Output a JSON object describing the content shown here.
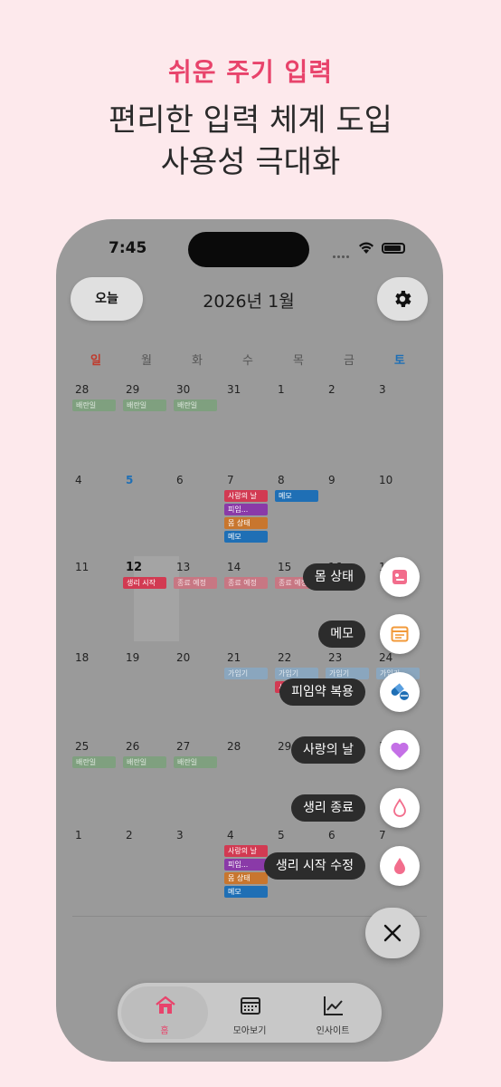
{
  "promo": {
    "tag": "쉬운 주기 입력",
    "line1": "편리한 입력 체계 도입",
    "line2": "사용성 극대화"
  },
  "status_bar": {
    "time": "7:45"
  },
  "header": {
    "today_label": "오늘",
    "month_title": "2026년 1월",
    "settings_icon": "gear-icon"
  },
  "weekdays": [
    "일",
    "월",
    "화",
    "수",
    "목",
    "금",
    "토"
  ],
  "weeks": [
    {
      "days": [
        "28",
        "29",
        "30",
        "31",
        "1",
        "2",
        "3"
      ],
      "events": [
        {
          "col": 0,
          "row": 0,
          "label": "배란일",
          "color": "#7fa07f",
          "text": "#dfe8df"
        },
        {
          "col": 1,
          "row": 0,
          "label": "배란일",
          "color": "#7fa07f",
          "text": "#dfe8df"
        },
        {
          "col": 2,
          "row": 0,
          "label": "배란일",
          "color": "#7fa07f",
          "text": "#dfe8df"
        }
      ]
    },
    {
      "days": [
        "4",
        "5",
        "6",
        "7",
        "8",
        "9",
        "10"
      ],
      "events": [
        {
          "col": 3,
          "row": 0,
          "label": "사랑의 날",
          "color": "#d23a52",
          "text": "#ffffff"
        },
        {
          "col": 3,
          "row": 1,
          "label": "피임...",
          "color": "#8a3aa8",
          "text": "#ffffff"
        },
        {
          "col": 3,
          "row": 2,
          "label": "몸 상태",
          "color": "#c8762e",
          "text": "#ffffff"
        },
        {
          "col": 3,
          "row": 3,
          "label": "메모",
          "color": "#1f6fb5",
          "text": "#ffffff"
        },
        {
          "col": 4,
          "row": 0,
          "label": "메모",
          "color": "#1f6fb5",
          "text": "#ffffff"
        }
      ]
    },
    {
      "days": [
        "11",
        "12",
        "13",
        "14",
        "15",
        "16",
        "17"
      ],
      "events": [
        {
          "col": 1,
          "row": 0,
          "label": "생리 시작",
          "color": "#d23a52",
          "text": "#ffffff"
        },
        {
          "col": 2,
          "row": 0,
          "label": "종료 예정",
          "color": "#c77783",
          "text": "#f3dde1"
        },
        {
          "col": 3,
          "row": 0,
          "label": "종료 예정",
          "color": "#c77783",
          "text": "#f3dde1"
        },
        {
          "col": 4,
          "row": 0,
          "label": "종료 예정",
          "color": "#c77783",
          "text": "#f3dde1"
        }
      ]
    },
    {
      "days": [
        "18",
        "19",
        "20",
        "21",
        "22",
        "23",
        "24"
      ],
      "events": [
        {
          "col": 3,
          "row": 0,
          "label": "가임기",
          "color": "#8aa6be",
          "text": "#dfe8f0"
        },
        {
          "col": 4,
          "row": 0,
          "label": "가임기",
          "color": "#8aa6be",
          "text": "#dfe8f0"
        },
        {
          "col": 4,
          "row": 1,
          "label": "사랑의 날",
          "color": "#d23a52",
          "text": "#ffffff"
        },
        {
          "col": 5,
          "row": 0,
          "label": "가임기",
          "color": "#8aa6be",
          "text": "#dfe8f0"
        },
        {
          "col": 6,
          "row": 0,
          "label": "가임기",
          "color": "#8aa6be",
          "text": "#dfe8f0"
        }
      ]
    },
    {
      "days": [
        "25",
        "26",
        "27",
        "28",
        "29",
        "30",
        "31"
      ],
      "events": [
        {
          "col": 0,
          "row": 0,
          "label": "배란일",
          "color": "#7fa07f",
          "text": "#dfe8df"
        },
        {
          "col": 1,
          "row": 0,
          "label": "배란일",
          "color": "#7fa07f",
          "text": "#dfe8df"
        },
        {
          "col": 2,
          "row": 0,
          "label": "배란일",
          "color": "#7fa07f",
          "text": "#dfe8df"
        }
      ]
    },
    {
      "days": [
        "1",
        "2",
        "3",
        "4",
        "5",
        "6",
        "7"
      ],
      "events": [
        {
          "col": 3,
          "row": 0,
          "label": "사랑의 날",
          "color": "#d23a52",
          "text": "#ffffff"
        },
        {
          "col": 3,
          "row": 1,
          "label": "피임...",
          "color": "#8a3aa8",
          "text": "#ffffff"
        },
        {
          "col": 3,
          "row": 2,
          "label": "몸 상태",
          "color": "#c8762e",
          "text": "#ffffff"
        },
        {
          "col": 3,
          "row": 3,
          "label": "메모",
          "color": "#1f6fb5",
          "text": "#ffffff"
        }
      ]
    }
  ],
  "quick_actions": [
    {
      "label": "몸 상태",
      "icon": "body-condition-icon"
    },
    {
      "label": "메모",
      "icon": "memo-icon"
    },
    {
      "label": "피임약 복용",
      "icon": "pill-icon"
    },
    {
      "label": "사랑의 날",
      "icon": "heart-icon"
    },
    {
      "label": "생리 종료",
      "icon": "drop-outline-icon"
    },
    {
      "label": "생리 시작 수정",
      "icon": "drop-filled-icon"
    }
  ],
  "close_button": {
    "icon": "close-icon"
  },
  "tabs": [
    {
      "label": "홈",
      "icon": "home-icon",
      "active": true
    },
    {
      "label": "모아보기",
      "icon": "calendar-grid-icon",
      "active": false
    },
    {
      "label": "인사이트",
      "icon": "chart-icon",
      "active": false
    }
  ],
  "colors": {
    "accent": "#e8436b",
    "sunday": "#c0392b",
    "saturday": "#1f6fb5",
    "today_number": "#111111",
    "highlight_number": "#1f6fb5"
  }
}
